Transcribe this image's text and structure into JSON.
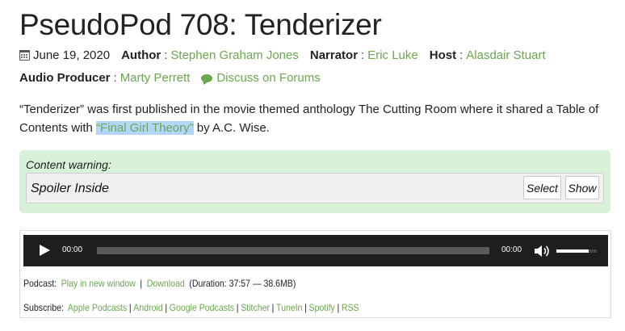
{
  "post": {
    "title": "PseudoPod 708: Tenderizer",
    "date": "June 19, 2020",
    "author_label": "Author",
    "author": "Stephen Graham Jones",
    "narrator_label": "Narrator",
    "narrator": "Eric Luke",
    "host_label": "Host",
    "host": "Alasdair Stuart",
    "producer_label": "Audio Producer",
    "producer": "Marty Perrett",
    "discuss": "Discuss on Forums",
    "separator": ":"
  },
  "description": {
    "part1": "“Tenderizer” was first published in the movie themed anthology The Cutting Room where it shared a Table of Contents with ",
    "link": "“Final Girl Theory”",
    "part2": " by A.C. Wise."
  },
  "content_warning": {
    "label": "Content warning:",
    "spoiler_title": "Spoiler Inside",
    "select_label": "Select",
    "show_label": "Show"
  },
  "player": {
    "current_time": "00:00",
    "duration": "00:00",
    "progress": 0,
    "volume": 0.8,
    "icons": {
      "play": "play-icon",
      "volume": "volume-icon"
    }
  },
  "podcast": {
    "label": "Podcast:",
    "play_new_window": "Play in new window",
    "download": "Download",
    "duration_info": "(Duration: 37:57 — 38.6MB)",
    "subscribe_label": "Subscribe:",
    "subscribe": [
      "Apple Podcasts",
      "Android",
      "Google Podcasts",
      "Stitcher",
      "TuneIn",
      "Spotify",
      "RSS"
    ],
    "divider": "|"
  },
  "colors": {
    "link": "#6aa84f",
    "warning_bg": "#d9f0d9",
    "player_bg": "#1e1e1e",
    "highlight": "#b4d5fe"
  }
}
